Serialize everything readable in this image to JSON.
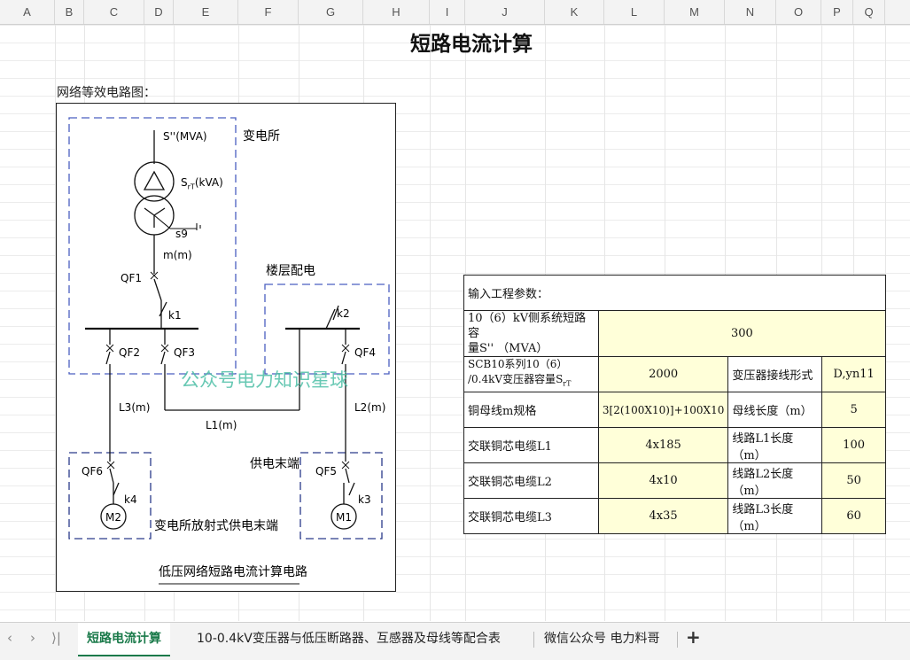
{
  "columns": [
    "A",
    "B",
    "C",
    "D",
    "E",
    "F",
    "G",
    "H",
    "I",
    "J",
    "K",
    "L",
    "M",
    "N",
    "O",
    "P",
    "Q"
  ],
  "sheet": {
    "title": "短路电流计算",
    "network_label": "网络等效电路图："
  },
  "diagram": {
    "labels": {
      "source": "S''(MVA)",
      "transformer_rating": "S",
      "transformer_rating_sub": "rT",
      "transformer_rating_unit": "(kVA)",
      "transformer_model": "s9",
      "substation": "变电所",
      "bus_length": "m(m)",
      "qf1": "QF1",
      "k1": "k1",
      "qf2": "QF2",
      "qf3": "QF3",
      "floor_dist": "楼层配电",
      "k2": "k2",
      "qf4": "QF4",
      "watermark": "公众号电力知识星球",
      "l3": "L3(m)",
      "l1": "L1(m)",
      "l2": "L2(m)",
      "end_supply": "供电末端",
      "qf6": "QF6",
      "k4": "k4",
      "m2": "M2",
      "qf5": "QF5",
      "k3": "k3",
      "m1": "M1",
      "radial_end": "变电所放射式供电末端",
      "caption": "低压网络短路电流计算电路"
    }
  },
  "params_table": {
    "header": "输入工程参数：",
    "system_capacity_label_1": "10（6）kV侧系统短路容",
    "system_capacity_label_2": "量S'' （MVA）",
    "system_capacity_value": "300",
    "transformer_label_1": "SCB10系列10（6）",
    "transformer_label_2": "/0.4kV变压器容量S",
    "transformer_label_sub": "rT",
    "transformer_value": "2000",
    "connection_label": "变压器接线形式",
    "connection_value": "D,yn11",
    "busbar_label": "铜母线m规格",
    "busbar_value": "3[2(100X10)]+100X10",
    "bus_len_label": "母线长度（m）",
    "bus_len_value": "5",
    "cable_l1_label": "交联铜芯电缆L1",
    "cable_l1_value": "4x185",
    "l1_len_label": "线路L1长度（m）",
    "l1_len_value": "100",
    "cable_l2_label": "交联铜芯电缆L2",
    "cable_l2_value": "4x10",
    "l2_len_label": "线路L2长度（m）",
    "l2_len_value": "50",
    "cable_l3_label": "交联铜芯电缆L3",
    "cable_l3_value": "4x35",
    "l3_len_label": "线路L3长度（m）",
    "l3_len_value": "60"
  },
  "tabs": {
    "prev": "‹",
    "next": "›",
    "last": "⟩|",
    "first": "‹",
    "items": [
      "短路电流计算",
      "10-0.4kV变压器与低压断路器、互感器及母线等配合表",
      "微信公众号 电力料哥"
    ],
    "add": "+"
  }
}
